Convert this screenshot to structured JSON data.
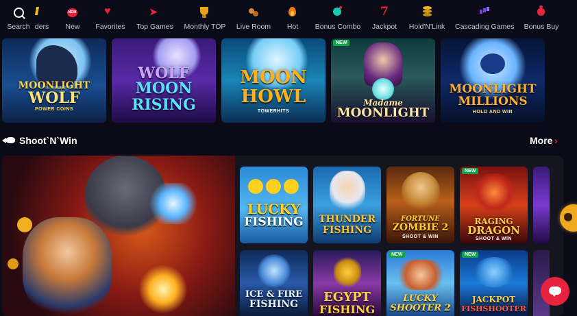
{
  "nav": {
    "items": [
      {
        "label": "Search",
        "icon": "search-icon"
      },
      {
        "label": "ders",
        "icon": "orders-icon"
      },
      {
        "label": "New",
        "icon": "new-icon"
      },
      {
        "label": "Favorites",
        "icon": "heart-icon"
      },
      {
        "label": "Top Games",
        "icon": "rocket-icon"
      },
      {
        "label": "Monthly TOP",
        "icon": "trophy-icon"
      },
      {
        "label": "Live Room",
        "icon": "live-room-icon"
      },
      {
        "label": "Hot",
        "icon": "fire-icon"
      },
      {
        "label": "Bonus Combo",
        "icon": "bonus-combo-icon"
      },
      {
        "label": "Jackpot",
        "icon": "seven-icon"
      },
      {
        "label": "Hold'N'Link",
        "icon": "coins-icon"
      },
      {
        "label": "Cascading Games",
        "icon": "cascading-icon"
      },
      {
        "label": "Bonus Buy",
        "icon": "bonus-bag-icon"
      }
    ],
    "new_icon_text": "NEW"
  },
  "top_row": [
    {
      "title_1": "MOONLIGHT",
      "title_2": "WOLF",
      "sub": "POWER COINS",
      "badge": ""
    },
    {
      "title_1": "WOLF",
      "title_2": "MOON",
      "title_3": "RISING",
      "badge": ""
    },
    {
      "title_1": "MOON",
      "title_2": "HOWL",
      "sub": "TOWERHITS",
      "badge": ""
    },
    {
      "title_1": "Madame",
      "title_2": "MOONLIGHT",
      "badge": "NEW"
    },
    {
      "title_1": "MOONLIGHT",
      "title_2": "MILLIONS",
      "sub": "HOLD AND WIN",
      "badge": ""
    }
  ],
  "section": {
    "title": "Shoot`N`Win",
    "more": "More",
    "chevron": "›"
  },
  "shoot_games": [
    {
      "title_1": "LUCKY",
      "title_2": "FISHING",
      "badge": ""
    },
    {
      "title_1": "THUNDER",
      "title_2": "FISHING",
      "badge": ""
    },
    {
      "title_1": "FORTUNE",
      "title_2": "ZOMBIE 2",
      "sub": "SHOOT & WIN",
      "badge": ""
    },
    {
      "title_1": "RAGING",
      "title_2": "DRAGON",
      "sub": "SHOOT & WIN",
      "badge": "NEW"
    },
    {
      "title_1": "ICE & FIRE",
      "title_2": "FISHING",
      "badge": ""
    },
    {
      "title_1": "EGYPT",
      "title_2": "FISHING",
      "badge": ""
    },
    {
      "title_1": "LUCKY",
      "title_2": "SHOOTER 2",
      "badge": "NEW"
    },
    {
      "title_1": "JACKPOT",
      "title_2": "FISHSHOOTER",
      "badge": "NEW"
    }
  ],
  "colors": {
    "background": "#0b0b17",
    "panel": "#15151f",
    "accent_red": "#e8233d",
    "new_badge": "#11a24a",
    "gold": "#f0a81e"
  }
}
